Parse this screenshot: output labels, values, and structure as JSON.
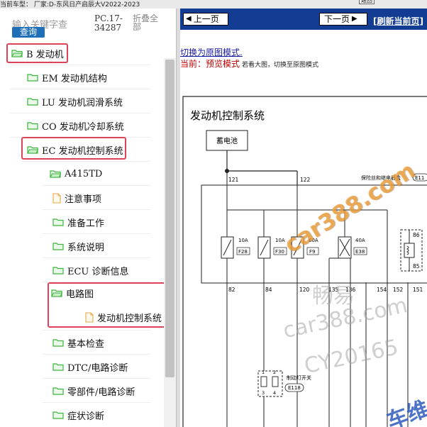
{
  "window": {
    "title": "当前车型：  厂家:D-东风日产启辰大V2022-2023",
    "top_button": "返回"
  },
  "sidebar": {
    "search_placeholder": "输入关键字查",
    "search_button": "查询",
    "pc_code": "PC.17-34287",
    "collapse_all": "折叠全部",
    "items": [
      {
        "label": "B 发动机",
        "icon": "folder-open-icon"
      },
      {
        "label": "EM 发动机结构",
        "icon": "folder-icon"
      },
      {
        "label": "LU 发动机润滑系统",
        "icon": "folder-icon"
      },
      {
        "label": "CO 发动机冷却系统",
        "icon": "folder-icon"
      },
      {
        "label": "EC 发动机控制系统",
        "icon": "folder-open-icon"
      },
      {
        "label": "A415TD",
        "icon": "folder-open-icon"
      },
      {
        "label": "注意事项",
        "icon": "document-icon"
      },
      {
        "label": "准备工作",
        "icon": "folder-icon"
      },
      {
        "label": "系统说明",
        "icon": "folder-icon"
      },
      {
        "label": "ECU 诊断信息",
        "icon": "folder-icon"
      },
      {
        "label": "电路图",
        "icon": "folder-open-icon"
      },
      {
        "label": "发动机控制系统",
        "icon": "document-icon"
      },
      {
        "label": "基本检查",
        "icon": "folder-icon"
      },
      {
        "label": "DTC/电路诊断",
        "icon": "folder-icon"
      },
      {
        "label": "零部件/电路诊断",
        "icon": "folder-icon"
      },
      {
        "label": "症状诊断",
        "icon": "folder-icon"
      }
    ]
  },
  "viewer": {
    "prev_page": "上一页",
    "next_page": "下一页",
    "refresh": "[刷新当前页]",
    "switch_mode": "切换为原图模式.",
    "mode_label": "当前：",
    "mode_value": "预览模式",
    "mode_hint": "若看大图，切换至原图模式"
  },
  "diagram": {
    "title": "发动机控制系统",
    "battery": "蓄电池",
    "wire_121": "121",
    "wire_122": "122",
    "fuse_box": "保险丝和继电器盒",
    "fuse_box_code": "E11",
    "fuse_1_rating": "10A",
    "fuse_1_code": "F28",
    "fuse_2_rating": "10A",
    "fuse_2_code": "F30",
    "fuse_3_rating": "60A",
    "fuse_3_code": "F9",
    "fuse_4_rating": "40A",
    "fuse_4_code": "E38",
    "relay_pin_top": "86",
    "relay_pin_bottom": "85",
    "wire_82": "82",
    "wire_84": "84",
    "wire_120": "120",
    "wire_135": "135",
    "wire_136": "136",
    "wire_154": "154",
    "wire_152": "152",
    "wire_151": "151",
    "switch_pin_1": "1",
    "switch_pin_2": "2",
    "switch_pin_3": "3",
    "switch_pin_4": "4",
    "brake_switch": "制动灯开关",
    "brake_switch_code": "E118"
  },
  "watermarks": [
    "car388.com",
    "畅易",
    "car388.com",
    "CY20165",
    "车维修"
  ],
  "colors": {
    "nav_bar": "#123d92",
    "highlight": "#e0415a",
    "search_button": "#1f6fb8",
    "folder_green": "#3cb43c",
    "mode_red": "#c00000",
    "watermark_orange": "#f0a23c"
  }
}
